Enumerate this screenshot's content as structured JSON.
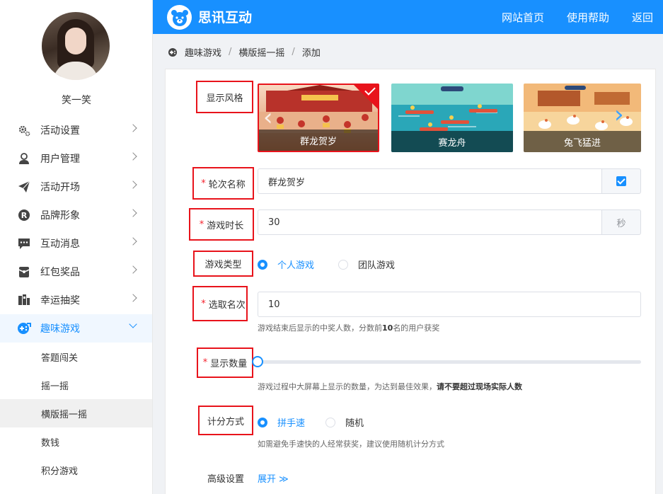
{
  "user": {
    "name": "笑一笑"
  },
  "sidebar": {
    "items": [
      {
        "label": "活动设置",
        "icon": "gears-icon"
      },
      {
        "label": "用户管理",
        "icon": "user-icon"
      },
      {
        "label": "活动开场",
        "icon": "paper-plane-icon"
      },
      {
        "label": "品牌形象",
        "icon": "registered-icon"
      },
      {
        "label": "互动消息",
        "icon": "message-icon"
      },
      {
        "label": "红包奖品",
        "icon": "gift-box-icon"
      },
      {
        "label": "幸运抽奖",
        "icon": "lottery-icon"
      },
      {
        "label": "趣味游戏",
        "icon": "gamepad-icon"
      }
    ],
    "sub_items": [
      {
        "label": "答题闯关"
      },
      {
        "label": "摇一摇"
      },
      {
        "label": "横版摇一摇"
      },
      {
        "label": "数钱"
      },
      {
        "label": "积分游戏"
      }
    ]
  },
  "header": {
    "brand": "思讯互动",
    "nav": [
      "网站首页",
      "使用帮助",
      "返回"
    ]
  },
  "breadcrumb": [
    "趣味游戏",
    "横版摇一摇",
    "添加"
  ],
  "form": {
    "style": {
      "label": "显示风格",
      "options": [
        "群龙贺岁",
        "赛龙舟",
        "兔飞猛进"
      ],
      "selected": 0
    },
    "round_name": {
      "label": "轮次名称",
      "value": "群龙贺岁"
    },
    "duration": {
      "label": "游戏时长",
      "value": "30",
      "unit": "秒"
    },
    "game_type": {
      "label": "游戏类型",
      "options": [
        "个人游戏",
        "团队游戏"
      ],
      "selected": 0
    },
    "winners": {
      "label": "选取名次",
      "value": "10",
      "hint_pre": "游戏结束后显示的中奖人数，分数前",
      "hint_num": "10",
      "hint_post": "名的用户获奖"
    },
    "display_count": {
      "label": "显示数量",
      "slider_value": 0,
      "hint": "游戏过程中大屏幕上显示的数量，为达到最佳效果，",
      "hint_bold": "请不要超过现场实际人数"
    },
    "scoring": {
      "label": "计分方式",
      "options": [
        "拼手速",
        "随机"
      ],
      "selected": 0,
      "hint": "如需避免手速快的人经常获奖，建议使用随机计分方式"
    },
    "advanced": {
      "label": "高级设置",
      "toggle": "展开 ≫"
    }
  },
  "colors": {
    "primary": "#1890ff",
    "highlight_box": "#e8131b"
  }
}
